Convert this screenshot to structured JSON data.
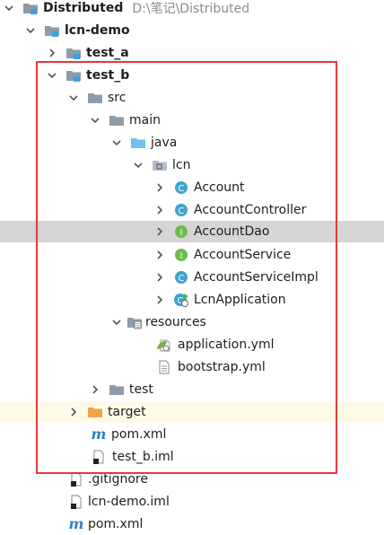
{
  "tree": {
    "root": {
      "label": "Distributed",
      "path": "D:\\笔记\\Distributed"
    },
    "lcn_demo": {
      "label": "lcn-demo"
    },
    "test_a": {
      "label": "test_a"
    },
    "test_b": {
      "label": "test_b"
    },
    "src": {
      "label": "src"
    },
    "main": {
      "label": "main"
    },
    "java": {
      "label": "java"
    },
    "lcn": {
      "label": "lcn"
    },
    "account": {
      "label": "Account",
      "badge": "C"
    },
    "account_controller": {
      "label": "AccountController",
      "badge": "C"
    },
    "account_dao": {
      "label": "AccountDao",
      "badge": "I"
    },
    "account_service": {
      "label": "AccountService",
      "badge": "I"
    },
    "account_service_impl": {
      "label": "AccountServiceImpl",
      "badge": "C"
    },
    "lcn_application": {
      "label": "LcnApplication",
      "badge": "C"
    },
    "resources": {
      "label": "resources"
    },
    "application_yml": {
      "label": "application.yml"
    },
    "bootstrap_yml": {
      "label": "bootstrap.yml"
    },
    "test": {
      "label": "test"
    },
    "target": {
      "label": "target"
    },
    "pom_inner": {
      "label": "pom.xml",
      "badge": "m"
    },
    "test_b_iml": {
      "label": "test_b.iml"
    },
    "gitignore": {
      "label": ".gitignore"
    },
    "lcn_demo_iml": {
      "label": "lcn-demo.iml"
    },
    "pom_root": {
      "label": "pom.xml",
      "badge": "m"
    }
  },
  "colors": {
    "selection": "#d5d5d5",
    "highlight_row": "#fdfbe7",
    "annotation_box": "#e23a3a",
    "class_badge": "#3fa3cc",
    "interface_badge": "#6cbc4f",
    "folder_grey": "#8e9aa6",
    "folder_blue": "#6fc2e8",
    "folder_orange": "#f5a04a",
    "module_marker": "#3aa3e0",
    "maven_blue": "#2d7fc1"
  }
}
